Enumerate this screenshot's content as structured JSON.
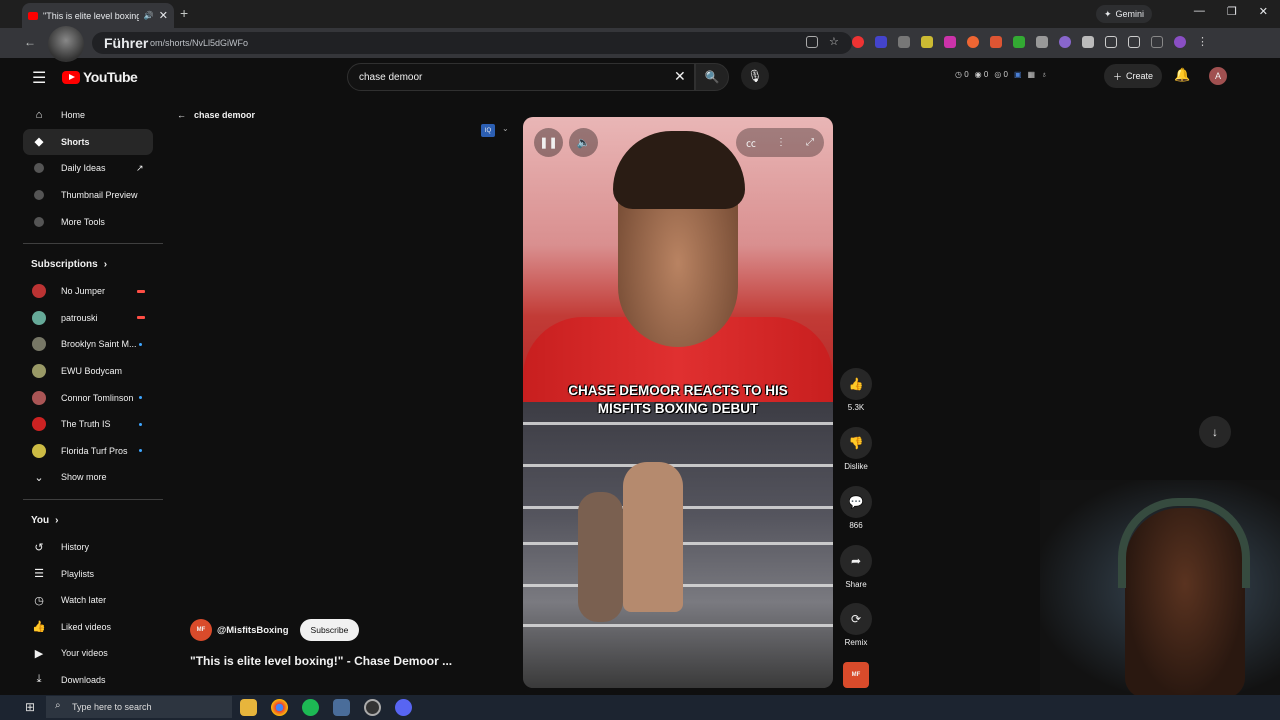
{
  "browser": {
    "tab_title": "\"This is elite level boxing!\"",
    "tab_close": "✕",
    "new_tab": "+",
    "url": "om/shorts/NvLl5dGiWFo",
    "overlay_text": "Führer",
    "gemini_label": "Gemini",
    "window_controls": [
      "—",
      "❐",
      "✕"
    ]
  },
  "youtube": {
    "logo_text": "YouTube",
    "search_value": "chase demoor",
    "search_clear": "✕",
    "stats": [
      "0",
      "0",
      "0"
    ],
    "create_label": "Create",
    "user_initial": "A"
  },
  "sidebar": {
    "main": [
      {
        "label": "Home",
        "icon": "home-icon",
        "glyph": "⌂"
      },
      {
        "label": "Shorts",
        "icon": "shorts-icon",
        "glyph": "◆",
        "active": true
      }
    ],
    "tools": [
      {
        "label": "Daily Ideas",
        "external": true
      },
      {
        "label": "Thumbnail Preview"
      },
      {
        "label": "More Tools"
      }
    ],
    "subscriptions_heading": "Subscriptions",
    "subscriptions": [
      {
        "label": "No Jumper",
        "color": "#b33",
        "indicator": "live"
      },
      {
        "label": "patrouski",
        "color": "#6a9",
        "indicator": "live"
      },
      {
        "label": "Brooklyn Saint M...",
        "color": "#776",
        "indicator": "dot"
      },
      {
        "label": "EWU Bodycam",
        "color": "#996",
        "indicator": ""
      },
      {
        "label": "Connor Tomlinson",
        "color": "#a55",
        "indicator": "dot"
      },
      {
        "label": "The Truth IS",
        "color": "#c22",
        "indicator": "dot"
      },
      {
        "label": "Florida Turf Pros",
        "color": "#cb4",
        "indicator": "dot"
      }
    ],
    "show_more": "Show more",
    "you_heading": "You",
    "you_items": [
      {
        "label": "History",
        "glyph": "↺"
      },
      {
        "label": "Playlists",
        "glyph": "☰"
      },
      {
        "label": "Watch later",
        "glyph": "◷"
      },
      {
        "label": "Liked videos",
        "glyph": "👍"
      },
      {
        "label": "Your videos",
        "glyph": "▶"
      },
      {
        "label": "Downloads",
        "glyph": "⤓"
      }
    ]
  },
  "main": {
    "breadcrumb": "chase demoor",
    "iq_badge": "IQ",
    "channel_avatar_text": "MF",
    "channel_handle": "@MisfitsBoxing",
    "subscribe_label": "Subscribe",
    "video_title": "\"This is elite level boxing!\" - Chase Demoor ...",
    "caption_line1": "CHASE DEMOOR REACTS TO HIS",
    "caption_line2": "MISFITS BOXING DEBUT"
  },
  "actions": [
    {
      "name": "like",
      "glyph": "👍",
      "label": "5.3K"
    },
    {
      "name": "dislike",
      "glyph": "👎",
      "label": "Dislike"
    },
    {
      "name": "comments",
      "glyph": "💬",
      "label": "866"
    },
    {
      "name": "share",
      "glyph": "➦",
      "label": "Share"
    },
    {
      "name": "remix",
      "glyph": "⟳",
      "label": "Remix"
    }
  ],
  "taskbar": {
    "search_placeholder": "Type here to search"
  }
}
